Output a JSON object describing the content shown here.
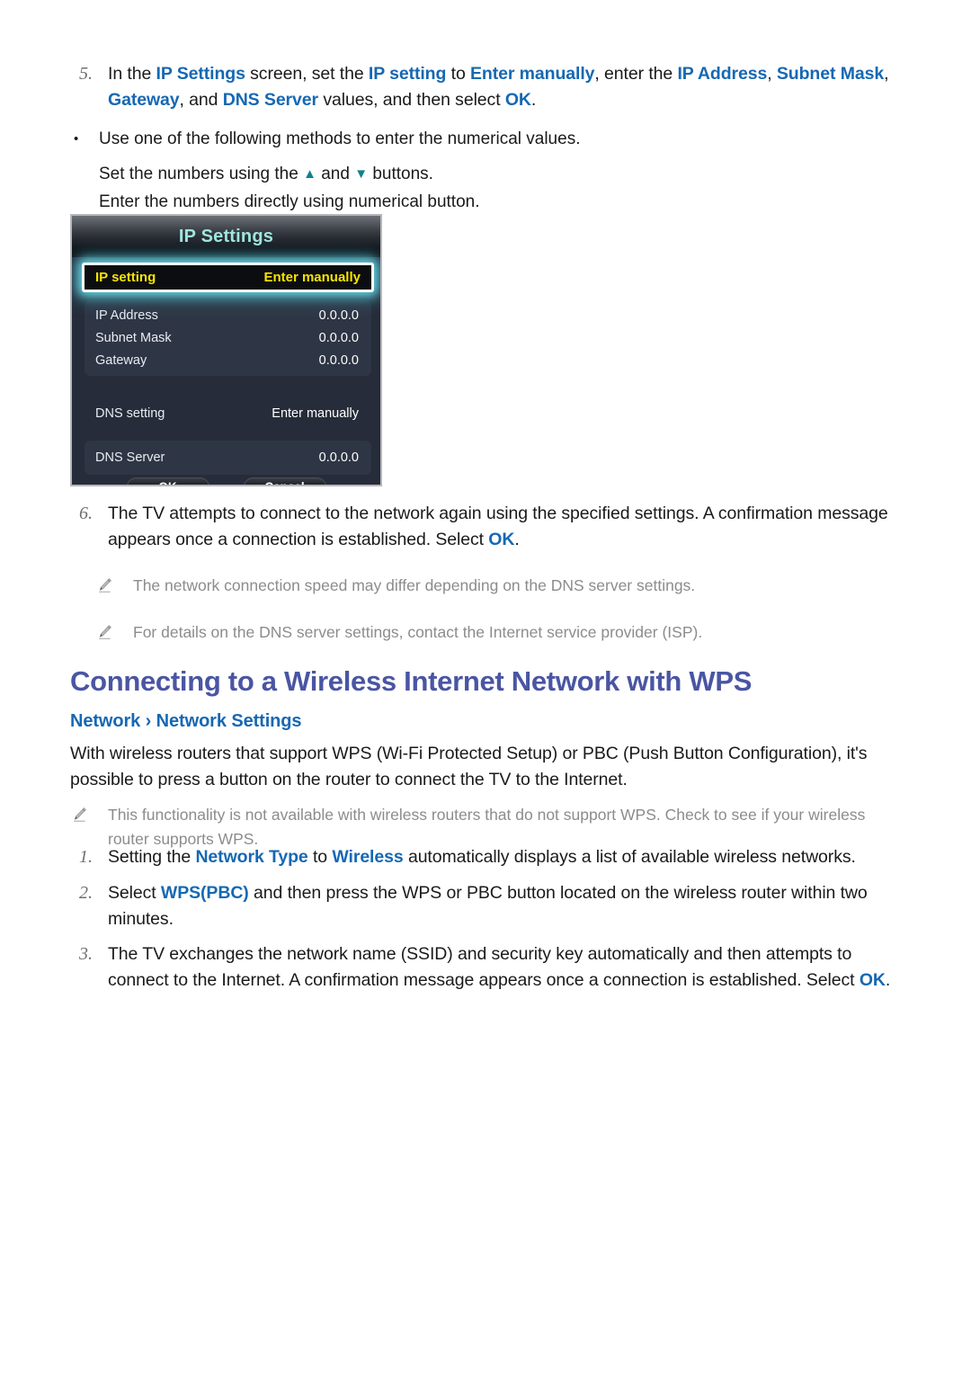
{
  "steps_top": [
    {
      "num": "5.",
      "segments": [
        {
          "t": "In the ",
          "hl": false
        },
        {
          "t": "IP Settings",
          "hl": true
        },
        {
          "t": " screen, set the ",
          "hl": false
        },
        {
          "t": "IP setting",
          "hl": true
        },
        {
          "t": " to ",
          "hl": false
        },
        {
          "t": "Enter manually",
          "hl": true
        },
        {
          "t": ", enter the ",
          "hl": false
        },
        {
          "t": "IP Address",
          "hl": true
        },
        {
          "t": ", ",
          "hl": false
        },
        {
          "t": "Subnet Mask",
          "hl": true
        },
        {
          "t": ", ",
          "hl": false
        },
        {
          "t": "Gateway",
          "hl": true
        },
        {
          "t": ", and ",
          "hl": false
        },
        {
          "t": "DNS Server",
          "hl": true
        },
        {
          "t": " values, and then select ",
          "hl": false
        },
        {
          "t": "OK",
          "hl": true
        },
        {
          "t": ".",
          "hl": false
        }
      ]
    }
  ],
  "step5_sub": {
    "bullet": "Use one of the following methods to enter the numerical values.",
    "line_a_before": "Set the numbers using the ",
    "line_a_up": "▲",
    "line_a_mid": " and ",
    "line_a_down": "▼",
    "line_a_after": " buttons.",
    "line_b": "Enter the numbers directly using numerical button."
  },
  "dialog": {
    "title": "IP Settings",
    "focused_row": {
      "label": "IP setting",
      "value": "Enter manually"
    },
    "group_one": [
      {
        "label": "IP Address",
        "value": "0.0.0.0"
      },
      {
        "label": "Subnet Mask",
        "value": "0.0.0.0"
      },
      {
        "label": "Gateway",
        "value": "0.0.0.0"
      }
    ],
    "dns_setting": {
      "label": "DNS setting",
      "value": "Enter manually"
    },
    "group_two": [
      {
        "label": "DNS Server",
        "value": "0.0.0.0"
      }
    ],
    "ok_button": "OK",
    "cancel_button": "Cancel",
    "colors": {
      "title_text": "#9fe6dd",
      "focus_text": "#f5e400",
      "focus_glow": "#6cdeeb",
      "panel_bg": "#262c39",
      "group_bg": "#2e3544"
    }
  },
  "step6": {
    "num": "6.",
    "segments": [
      {
        "t": "The TV attempts to connect to the network again using the specified settings. A confirmation message appears once a connection is established. Select ",
        "hl": false
      },
      {
        "t": "OK",
        "hl": true
      },
      {
        "t": ".",
        "hl": false
      }
    ]
  },
  "notes_after_step6": [
    "The network connection speed may differ depending on the DNS server settings.",
    "For details on the DNS server settings, contact the Internet service provider (ISP)."
  ],
  "section": {
    "title": "Connecting to a Wireless Internet Network with WPS",
    "breadcrumb": "Network › Network Settings",
    "intro": "With wireless routers that support WPS (Wi-Fi Protected Setup) or PBC (Push Button Configuration), it's possible to press a button on the router to connect the TV to the Internet.",
    "title_color": "#4a55a3",
    "link_color": "#1668b3"
  },
  "note_wps": "This functionality is not available with wireless routers that do not support WPS. Check to see if your wireless router supports WPS.",
  "steps_wps": [
    {
      "num": "1.",
      "segments": [
        {
          "t": "Setting the ",
          "hl": false
        },
        {
          "t": "Network Type",
          "hl": true
        },
        {
          "t": " to ",
          "hl": false
        },
        {
          "t": "Wireless",
          "hl": true
        },
        {
          "t": " automatically displays a list of available wireless networks.",
          "hl": false
        }
      ]
    },
    {
      "num": "2.",
      "segments": [
        {
          "t": "Select ",
          "hl": false
        },
        {
          "t": "WPS(PBC)",
          "hl": true
        },
        {
          "t": " and then press the WPS or PBC button located on the wireless router within two minutes.",
          "hl": false
        }
      ]
    },
    {
      "num": "3.",
      "segments": [
        {
          "t": "The TV exchanges the network name (SSID) and security key automatically and then attempts to connect to the Internet. A confirmation message appears once a connection is established. Select ",
          "hl": false
        },
        {
          "t": "OK",
          "hl": true
        },
        {
          "t": ".",
          "hl": false
        }
      ]
    }
  ],
  "icons": {
    "note": "pencil-icon",
    "bullet": "•"
  }
}
